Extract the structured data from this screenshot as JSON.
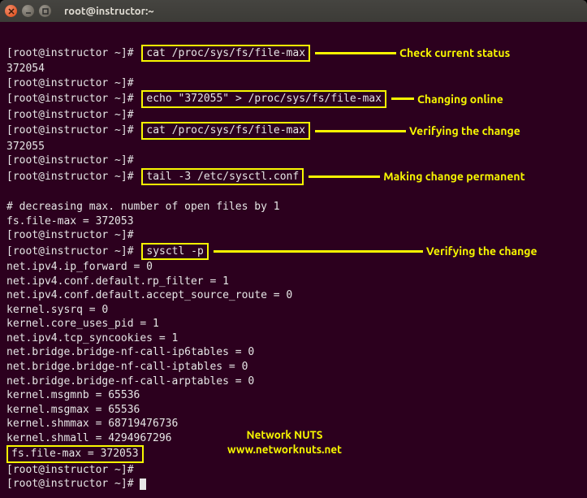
{
  "title": "root@instructor:~",
  "prompt": "[root@instructor ~]# ",
  "cmd1": "cat /proc/sys/fs/file-max",
  "out1": "372054",
  "cmd2": "echo \"372055\" > /proc/sys/fs/file-max",
  "cmd3": "cat /proc/sys/fs/file-max",
  "out3": "372055",
  "cmd4": "tail -3 /etc/sysctl.conf",
  "tail_out_a": "# decreasing max. number of open files by 1",
  "tail_out_b": "fs.file-max = 372053",
  "cmd5": "sysctl -p",
  "sysctl_lines": [
    "net.ipv4.ip_forward = 0",
    "net.ipv4.conf.default.rp_filter = 1",
    "net.ipv4.conf.default.accept_source_route = 0",
    "kernel.sysrq = 0",
    "kernel.core_uses_pid = 1",
    "net.ipv4.tcp_syncookies = 1",
    "net.bridge.bridge-nf-call-ip6tables = 0",
    "net.bridge.bridge-nf-call-iptables = 0",
    "net.bridge.bridge-nf-call-arptables = 0",
    "kernel.msgmnb = 65536",
    "kernel.msgmax = 65536",
    "kernel.shmmax = 68719476736",
    "kernel.shmall = 4294967296"
  ],
  "sysctl_last": "fs.file-max = 372053",
  "ann1": "Check current status",
  "ann2": "Changing online",
  "ann3": "Verifying the change",
  "ann4": "Making change permanent",
  "ann5": "Verifying the change",
  "brand1": "Network NUTS",
  "brand2": "www.networknuts.net"
}
